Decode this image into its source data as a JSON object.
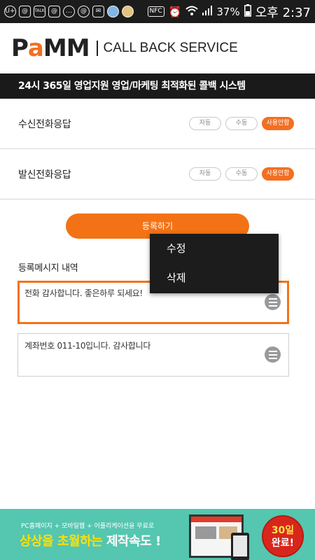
{
  "status_bar": {
    "left_icons": [
      "U+",
      "@",
      "TALK",
      "@",
      "chat-bubble",
      "@",
      "mail",
      "avatar",
      "avatar"
    ],
    "nfc": "NFC",
    "battery": "37%",
    "time": "오후 2:37"
  },
  "header": {
    "logo": {
      "p": "P",
      "a": "a",
      "mm": "MM"
    },
    "title": "CALL BACK SERVICE"
  },
  "banner": {
    "text": "24시 365일 영업지원 영업/마케팅 최적화된 콜백 시스템"
  },
  "settings": [
    {
      "label": "수신전화응답",
      "options": [
        "자동",
        "수동",
        "사용안함"
      ],
      "selected": "사용안함"
    },
    {
      "label": "발신전화응답",
      "options": [
        "자동",
        "수동",
        "사용안함"
      ],
      "selected": "사용안함"
    }
  ],
  "register_button": "등록하기",
  "section_title": "등록메시지 내역",
  "messages": [
    {
      "text": "전화 감사합니다. 좋은하루 되세요!",
      "selected": true
    },
    {
      "text": "계좌번호 011-10입니다. 감사합니다",
      "selected": false
    }
  ],
  "context_menu": {
    "items": [
      "수정",
      "삭제"
    ]
  },
  "ad": {
    "small_text": "PC홈페이지 + 모바일웹 + 어플리케이션을 무료로",
    "headline_yellow": "상상을 초월하는",
    "headline_white": " 제작속도 !",
    "badge_line1": "30일",
    "badge_line2": "완료!"
  },
  "colors": {
    "accent_orange": "#f47216",
    "banner_black": "#1a1a1a",
    "ad_teal": "#55c6b0",
    "badge_red": "#d9261c"
  }
}
